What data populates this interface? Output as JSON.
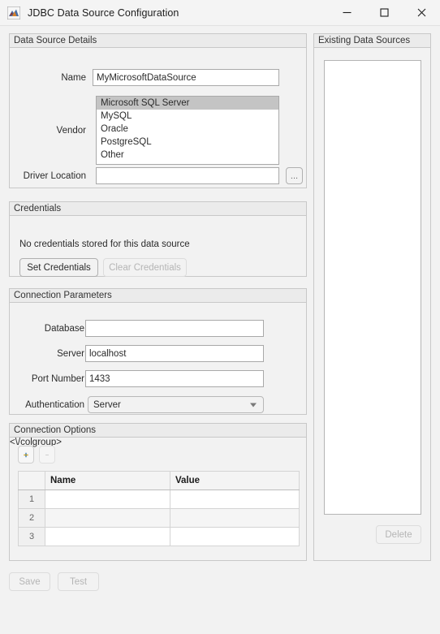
{
  "window": {
    "title": "JDBC Data Source Configuration",
    "icon": "matlab-membrane-icon",
    "controls": {
      "minimize": "minimize-icon",
      "maximize": "maximize-icon",
      "close": "close-icon"
    }
  },
  "data_source_details": {
    "title": "Data Source Details",
    "name_label": "Name",
    "name_value": "MyMicrosoftDataSource",
    "name_placeholder": "",
    "vendor_label": "Vendor",
    "vendor_options": [
      "Microsoft SQL Server",
      "MySQL",
      "Oracle",
      "PostgreSQL",
      "Other"
    ],
    "vendor_selected": "Microsoft SQL Server",
    "driver_location_label": "Driver Location",
    "driver_location_value": "",
    "driver_location_placeholder": "",
    "browse_button": "..."
  },
  "credentials": {
    "title": "Credentials",
    "status_text": "No credentials stored for this data source",
    "set_button": "Set Credentials",
    "clear_button": "Clear Credentials",
    "clear_enabled": false
  },
  "connection_parameters": {
    "title": "Connection Parameters",
    "database_label": "Database",
    "database_value": "",
    "server_label": "Server",
    "server_value": "localhost",
    "port_label": "Port Number",
    "port_value": "1433",
    "authentication_label": "Authentication",
    "authentication_value": "Server"
  },
  "connection_options": {
    "title": "Connection Options",
    "add_button": "+",
    "remove_button": "-",
    "columns": [
      "",
      "Name",
      "Value"
    ],
    "rows": [
      {
        "index": "1",
        "name": "",
        "value": ""
      },
      {
        "index": "2",
        "name": "",
        "value": ""
      },
      {
        "index": "3",
        "name": "",
        "value": ""
      }
    ]
  },
  "existing_data_sources": {
    "title": "Existing Data Sources",
    "items": [],
    "delete_button": "Delete",
    "delete_enabled": false
  },
  "footer": {
    "save_button": "Save",
    "test_button": "Test",
    "save_enabled": false,
    "test_enabled": false
  },
  "colors": {
    "window_background": "#f2f2f2",
    "panel_border": "#c8c8c8",
    "selection": "#c4c4c4",
    "field_background": "#ffffff",
    "disabled_text": "#b5b5b5"
  }
}
